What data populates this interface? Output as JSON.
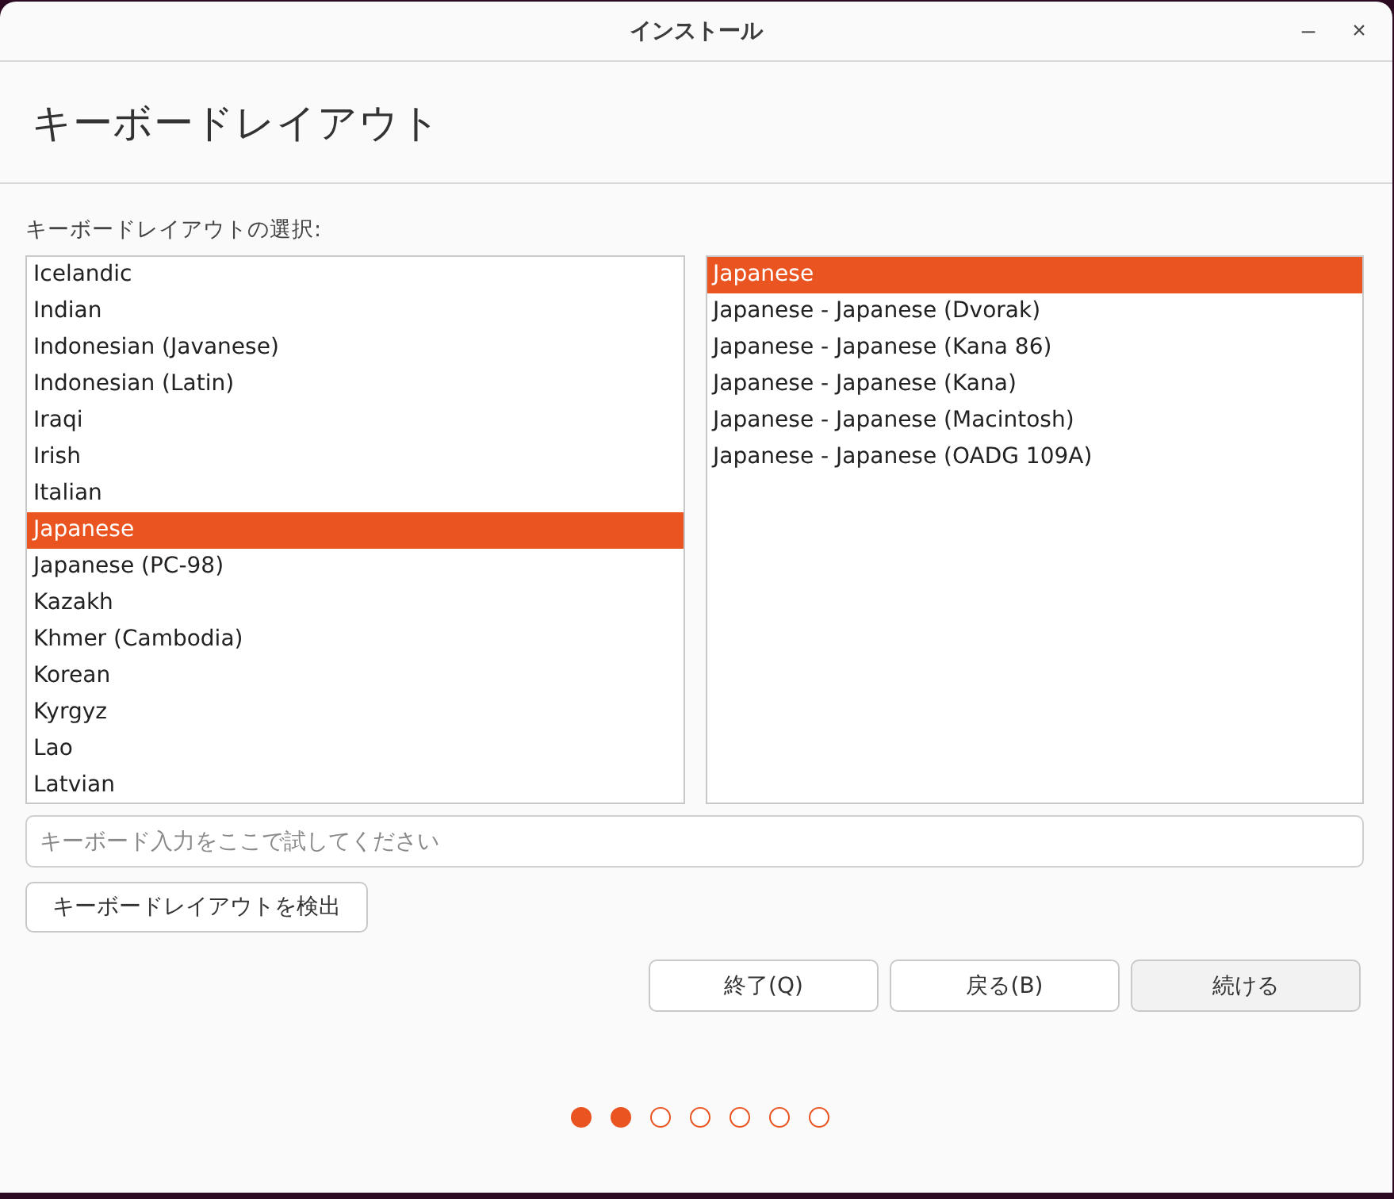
{
  "window": {
    "title": "インストール",
    "buttons": [
      "–",
      "×"
    ]
  },
  "heading": "キーボードレイアウト",
  "layout_label": "キーボードレイアウトの選択:",
  "layouts": [
    {
      "label": "Icelandic",
      "selected": false
    },
    {
      "label": "Indian",
      "selected": false
    },
    {
      "label": "Indonesian (Javanese)",
      "selected": false
    },
    {
      "label": "Indonesian (Latin)",
      "selected": false
    },
    {
      "label": "Iraqi",
      "selected": false
    },
    {
      "label": "Irish",
      "selected": false
    },
    {
      "label": "Italian",
      "selected": false
    },
    {
      "label": "Japanese",
      "selected": true
    },
    {
      "label": "Japanese (PC-98)",
      "selected": false
    },
    {
      "label": "Kazakh",
      "selected": false
    },
    {
      "label": "Khmer (Cambodia)",
      "selected": false
    },
    {
      "label": "Korean",
      "selected": false
    },
    {
      "label": "Kyrgyz",
      "selected": false
    },
    {
      "label": "Lao",
      "selected": false
    },
    {
      "label": "Latvian",
      "selected": false
    }
  ],
  "variants": [
    {
      "label": "Japanese",
      "selected": true
    },
    {
      "label": "Japanese - Japanese (Dvorak)",
      "selected": false
    },
    {
      "label": "Japanese - Japanese (Kana 86)",
      "selected": false
    },
    {
      "label": "Japanese - Japanese (Kana)",
      "selected": false
    },
    {
      "label": "Japanese - Japanese (Macintosh)",
      "selected": false
    },
    {
      "label": "Japanese - Japanese (OADG 109A)",
      "selected": false
    }
  ],
  "test_field": {
    "placeholder": "キーボード入力をここで試してください"
  },
  "detect_button": "キーボードレイアウトを検出",
  "buttons": [
    {
      "label": "終了(Q)",
      "kind": "normal"
    },
    {
      "label": "戻る(B)",
      "kind": "normal"
    },
    {
      "label": "続ける",
      "kind": "default"
    }
  ],
  "progress": [
    {
      "filled": true
    },
    {
      "filled": true
    },
    {
      "filled": false
    },
    {
      "filled": false
    },
    {
      "filled": false
    },
    {
      "filled": false
    },
    {
      "filled": false
    }
  ]
}
